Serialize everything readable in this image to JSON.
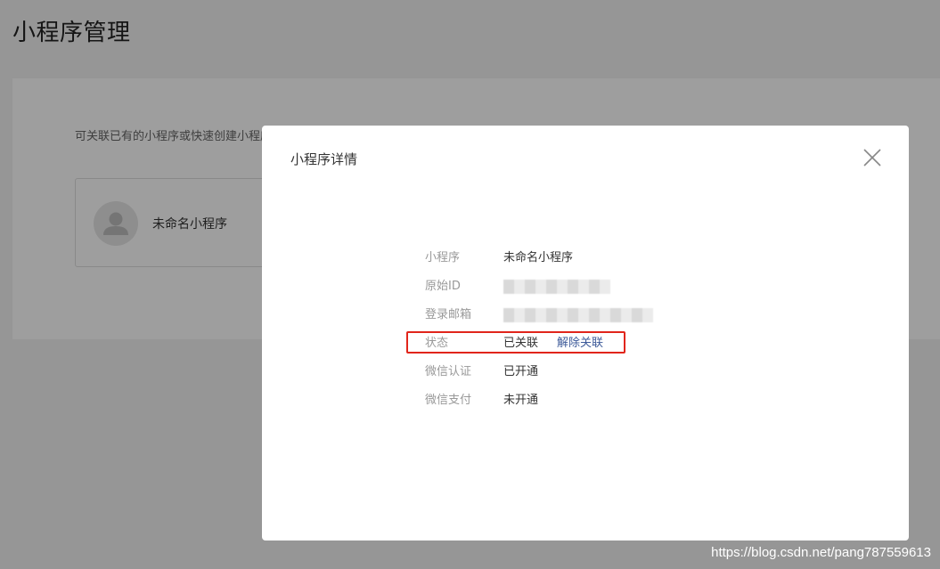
{
  "page": {
    "title": "小程序管理"
  },
  "panel": {
    "description": "可关联已有的小程序或快速创建小程序",
    "app_card": {
      "name": "未命名小程序"
    }
  },
  "dialog": {
    "title": "小程序详情",
    "rows": [
      {
        "label": "小程序",
        "value": "未命名小程序"
      },
      {
        "label": "原始ID",
        "value": ""
      },
      {
        "label": "登录邮箱",
        "value": ""
      },
      {
        "label": "状态",
        "value": "已关联",
        "action": "解除关联"
      },
      {
        "label": "微信认证",
        "value": "已开通"
      },
      {
        "label": "微信支付",
        "value": "未开通"
      }
    ]
  },
  "watermark": "https://blog.csdn.net/pang787559613",
  "colors": {
    "link": "#3d5a99",
    "highlight": "#e1251b"
  }
}
